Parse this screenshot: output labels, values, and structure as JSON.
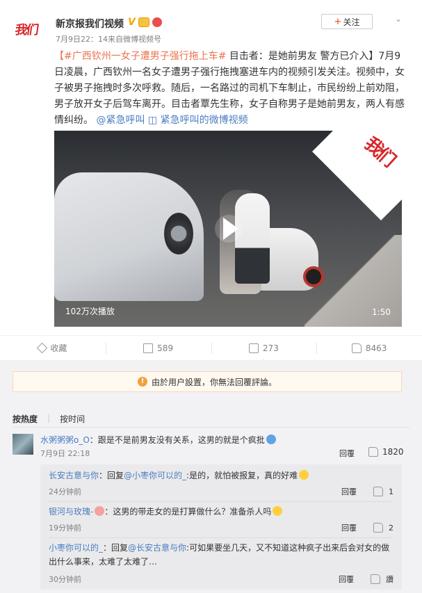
{
  "header": {
    "avatar_text": "我们",
    "username": "新京报我们视频",
    "verified_badge": "V",
    "meta": "7月9日22：14来自微博视频号",
    "follow_label": "关注"
  },
  "post": {
    "topic": "【#广西钦州一女子遭男子强行拖上车#",
    "text_1": " 目击者：是她前男友 警方已介入】7月9日凌晨，广西钦州一名女子遭男子强行拖拽塞进车内的视频引发关注。视频中，女子被男子拖拽时多次呼救。随后，一名路过的司机下车制止，市民纷纷上前劝阻，男子放开女子后驾车离开。目击者覃先生称，女子自称男子是她前男友，两人有感情纠纷。",
    "mention": "@紧急呼叫",
    "video_link": "紧急呼叫的微博视频"
  },
  "video": {
    "watermark": "我们",
    "play_count": "102万次播放",
    "duration": "1:50"
  },
  "actions": {
    "favorite_label": "收藏",
    "share_count": "589",
    "comment_count": "273",
    "like_count": "8463"
  },
  "notice": {
    "text": "由於用户設置，你無法回覆評論。"
  },
  "sort": {
    "by_heat": "按热度",
    "by_time": "按时间"
  },
  "comments": [
    {
      "user": "水粥粥粥o_O",
      "text": "：跟是不是前男友没有关系，这男的就是个疯批",
      "time": "7月9日 22:18",
      "reply_label": "回覆",
      "likes": "1820",
      "replies": [
        {
          "user": "长安古意与你",
          "prefix": "：回复",
          "mention": "@小枣你可以的_",
          "text": ":是的，就怕被报复，真的好难",
          "time": "24分钟前",
          "reply_label": "回覆",
          "likes": "1"
        },
        {
          "user": "银河与玫瑰-",
          "text": "：这男的带走女的是打算做什么？准备杀人吗",
          "time": "19分钟前",
          "reply_label": "回覆",
          "likes": "2"
        },
        {
          "user": "小枣你可以的_",
          "prefix": "：回复",
          "mention": "@长安古意与你",
          "text": ":可如果要坐几天，又不知道这种疯子出来后会对女的做出什么事来，太难了太难了…",
          "time": "30分钟前",
          "reply_label": "回覆",
          "likes": "讚"
        }
      ]
    }
  ]
}
